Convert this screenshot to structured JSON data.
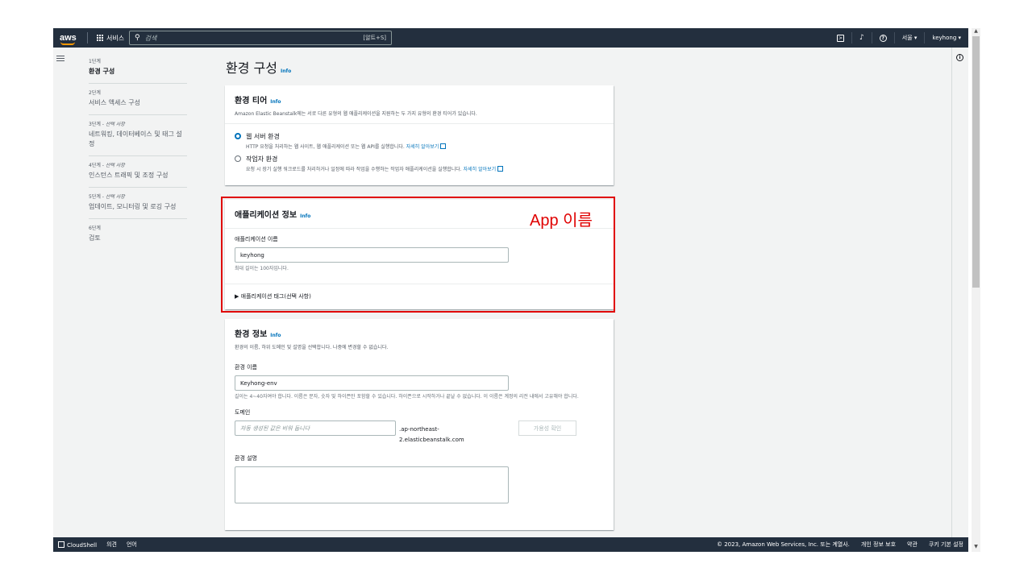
{
  "topbar": {
    "logo": "aws",
    "services_label": "서비스",
    "search_placeholder": "검색",
    "search_shortcut": "[알트+S]",
    "region": "서울 ▾",
    "user": "keyhong ▾"
  },
  "sidebar": {
    "steps": [
      {
        "num": "1단계",
        "optional": "",
        "title": "환경 구성"
      },
      {
        "num": "2단계",
        "optional": "",
        "title": "서비스 액세스 구성"
      },
      {
        "num": "3단계 - ",
        "optional": "선택 사항",
        "title": "네트워킹, 데이터베이스 및 태그 설정"
      },
      {
        "num": "4단계 - ",
        "optional": "선택 사항",
        "title": "인스턴스 트래픽 및 조정 구성"
      },
      {
        "num": "5단계 - ",
        "optional": "선택 사항",
        "title": "업데이트, 모니터링 및 로깅 구성"
      },
      {
        "num": "6단계",
        "optional": "",
        "title": "검토"
      }
    ]
  },
  "main": {
    "title": "환경 구성",
    "info": "Info",
    "tier": {
      "title": "환경 티어",
      "desc": "Amazon Elastic Beanstalk에는 서로 다른 유형의 웹 애플리케이션을 지원하는 두 가지 유형의 환경 티어가 있습니다.",
      "web_label": "웹 서버 환경",
      "web_desc": "HTTP 요청을 처리하는 웹 사이트, 웹 애플리케이션 또는 웹 API를 실행합니다.",
      "worker_label": "작업자 환경",
      "worker_desc": "요청 시 장기 실행 워크로드를 처리하거나 일정에 따라 작업을 수행하는 작업자 애플리케이션을 실행합니다.",
      "learn_more": "자세히 알아보기"
    },
    "app": {
      "title": "애플리케이션 정보",
      "name_label": "애플리케이션 이름",
      "name_value": "keyhong",
      "name_hint": "최대 길이는 100자입니다.",
      "tags_label": "애플리케이션 태그(선택 사항)"
    },
    "env": {
      "title": "환경 정보",
      "desc": "환경의 이름, 하위 도메인 및 설명을 선택합니다. 나중에 변경할 수 없습니다.",
      "name_label": "환경 이름",
      "name_value": "Keyhong-env",
      "name_hint": "길이는 4~40자여야 합니다. 이름은 문자, 숫자 및 하이픈만 포함할 수 있습니다. 하이픈으로 시작하거나 끝날 수 없습니다. 이 이름은 계정의 리전 내에서 고유해야 합니다.",
      "domain_label": "도메인",
      "domain_placeholder": "자동 생성된 값은 비워 둡니다",
      "domain_suffix_1": ".ap-northeast-",
      "domain_suffix_2": "2.elasticbeanstalk.com",
      "check_button": "가용성 확인",
      "desc_label": "환경 설명"
    }
  },
  "annotation": "App 이름",
  "footer": {
    "cloudshell": "CloudShell",
    "feedback": "의견",
    "language": "언어",
    "copyright": "© 2023, Amazon Web Services, Inc. 또는 계열사.",
    "privacy": "개인 정보 보호",
    "terms": "약관",
    "cookies": "쿠키 기본 설정"
  }
}
